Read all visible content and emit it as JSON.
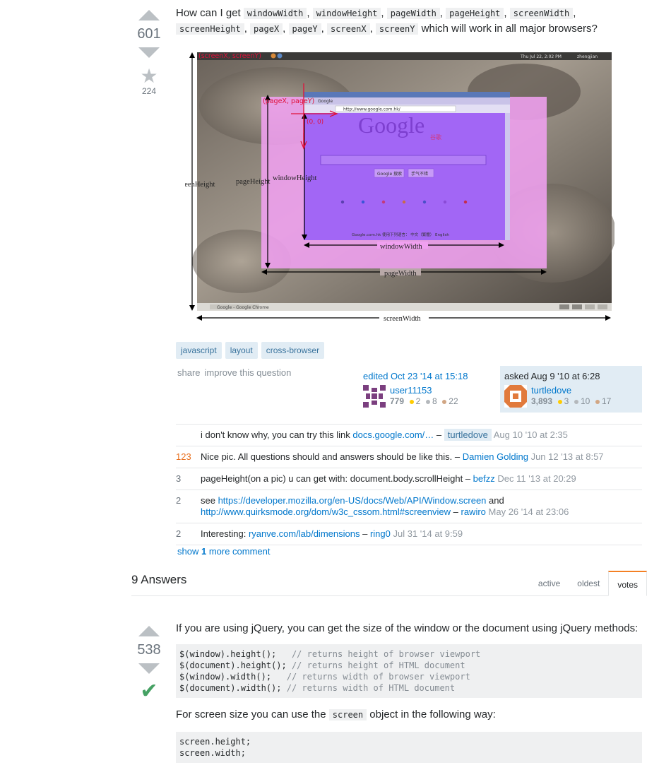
{
  "question": {
    "votes": "601",
    "favorites": "224",
    "text_before": "How can I get ",
    "code_terms": [
      "windowWidth",
      "windowHeight",
      "pageWidth",
      "pageHeight",
      "screenWidth",
      "screenHeight",
      "pageX",
      "pageY",
      "screenX",
      "screenY"
    ],
    "text_after": " which will work in all major browsers?",
    "tags": [
      "javascript",
      "layout",
      "cross-browser"
    ],
    "share_label": "share",
    "improve_label": "improve this question",
    "edited": {
      "when": "edited Oct 23 '14 at 15:18",
      "user": "user11153",
      "rep": "779",
      "gold": "2",
      "silver": "8",
      "bronze": "22"
    },
    "asked": {
      "when": "asked Aug 9 '10 at 6:28",
      "user": "turtledove",
      "rep": "3,893",
      "gold": "3",
      "silver": "10",
      "bronze": "17"
    }
  },
  "diagram": {
    "labels": {
      "screen_xy": "(screenX, screenY)",
      "page_xy": "(pageX, pageY)",
      "origin": "(0, 0)",
      "screen_height": "screenHeight",
      "page_height": "pageHeight",
      "window_height": "windowHeight",
      "window_width": "windowWidth",
      "page_width": "pageWidth",
      "screen_width": "screenWidth"
    },
    "desktop_clock": "Thu Jul 22, 2:02 PM",
    "desktop_user": "zhengjian",
    "browser_tab": "Google",
    "url": "http://www.google.com.hk/",
    "logo": "Google",
    "logo_sub": "谷歌",
    "search_btn": "Google 搜索",
    "lucky_btn": "手气不错",
    "footer_line": "Google.com.hk 使用下列语言： 中文（繁體） English",
    "taskbar_item": "Google - Google Chrome"
  },
  "comments": [
    {
      "score": "",
      "text": "i don't know why, you can try this link ",
      "link": "docs.google.com/…",
      "sep": " – ",
      "user": "turtledove",
      "op": true,
      "date": "Aug 10 '10 at 2:35"
    },
    {
      "score": "123",
      "text": "Nice pic. All questions should and answers should be like this.",
      "link": "",
      "sep": " – ",
      "user": "Damien Golding",
      "op": false,
      "date": "Jun 12 '13 at 8:57"
    },
    {
      "score": "3",
      "text": "pageHeight(on a pic) u can get with: document.body.scrollHeight",
      "link": "",
      "sep": " – ",
      "user": "befzz",
      "op": false,
      "date": "Dec 11 '13 at 20:29"
    },
    {
      "score": "2",
      "text": "see ",
      "link": "https://developer.mozilla.org/en-US/docs/Web/API/Window.screen",
      "text2": " and ",
      "link2": "http://www.quirksmode.org/dom/w3c_cssom.html#screenview",
      "sep": " – ",
      "user": "rawiro",
      "op": false,
      "date": "May 26 '14 at 23:06"
    },
    {
      "score": "2",
      "text": "Interesting: ",
      "link": "ryanve.com/lab/dimensions",
      "sep": " – ",
      "user": "ring0",
      "op": false,
      "date": "Jul 31 '14 at 9:59"
    }
  ],
  "show_more": {
    "prefix": "show ",
    "count": "1",
    "suffix": " more comment"
  },
  "answers": {
    "title": "9 Answers",
    "tabs": [
      "active",
      "oldest",
      "votes"
    ],
    "active_tab": "votes"
  },
  "answer": {
    "votes": "538",
    "p1": "If you are using jQuery, you can get the size of the window or the document using jQuery methods:",
    "code1": [
      {
        "code": "$(window).height();   ",
        "comment": "// returns height of browser viewport"
      },
      {
        "code": "$(document).height(); ",
        "comment": "// returns height of HTML document"
      },
      {
        "code": "$(window).width();   ",
        "comment": "// returns width of browser viewport"
      },
      {
        "code": "$(document).width(); ",
        "comment": "// returns width of HTML document"
      }
    ],
    "p2_before": "For screen size you can use the ",
    "p2_code": "screen",
    "p2_after": " object in the following way:",
    "code2": [
      "screen.height;",
      "screen.width;"
    ]
  },
  "colors": {
    "link": "#0077cc",
    "accepted": "#45a163",
    "page_overlay": "#f0a0f0",
    "window_overlay": "#9b4dff",
    "annot_red": "#e0103a"
  }
}
